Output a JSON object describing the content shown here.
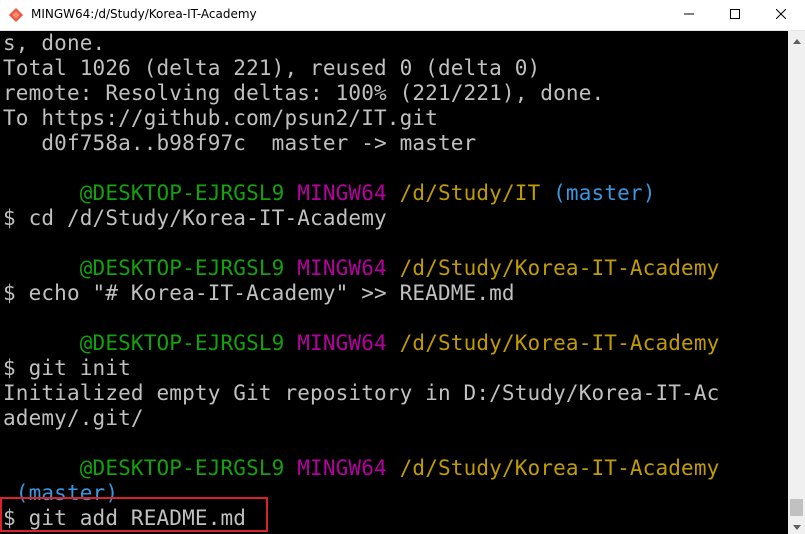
{
  "window": {
    "title": "MINGW64:/d/Study/Korea-IT-Academy",
    "app_icon": "mingw-diamond-icon",
    "controls": [
      "minimize-icon",
      "maximize-icon",
      "close-icon"
    ]
  },
  "terminal": {
    "lines": [
      {
        "segments": [
          {
            "text": "s, done.",
            "color": "white"
          }
        ]
      },
      {
        "segments": [
          {
            "text": "Total 1026 (delta 221), reused 0 (delta 0)",
            "color": "white"
          }
        ]
      },
      {
        "segments": [
          {
            "text": "remote: Resolving deltas: 100% (221/221), done.",
            "color": "white"
          }
        ]
      },
      {
        "segments": [
          {
            "text": "To https://github.com/psun2/IT.git",
            "color": "white"
          }
        ]
      },
      {
        "segments": [
          {
            "text": "   d0f758a..b98f97c  master -> master",
            "color": "white"
          }
        ]
      },
      {
        "segments": []
      },
      {
        "segments": [
          {
            "text": "      @DESKTOP-EJRGSL9 ",
            "color": "green"
          },
          {
            "text": "MINGW64 ",
            "color": "magenta"
          },
          {
            "text": "/d/Study/IT ",
            "color": "yellow"
          },
          {
            "text": "(master)",
            "color": "cyan"
          }
        ]
      },
      {
        "segments": [
          {
            "text": "$ cd /d/Study/Korea-IT-Academy",
            "color": "white"
          }
        ]
      },
      {
        "segments": []
      },
      {
        "segments": [
          {
            "text": "      @DESKTOP-EJRGSL9 ",
            "color": "green"
          },
          {
            "text": "MINGW64 ",
            "color": "magenta"
          },
          {
            "text": "/d/Study/Korea-IT-Academy",
            "color": "yellow"
          }
        ]
      },
      {
        "segments": [
          {
            "text": "$ echo \"# Korea-IT-Academy\" >> README.md",
            "color": "white"
          }
        ]
      },
      {
        "segments": []
      },
      {
        "segments": [
          {
            "text": "      @DESKTOP-EJRGSL9 ",
            "color": "green"
          },
          {
            "text": "MINGW64 ",
            "color": "magenta"
          },
          {
            "text": "/d/Study/Korea-IT-Academy",
            "color": "yellow"
          }
        ]
      },
      {
        "segments": [
          {
            "text": "$ git init",
            "color": "white"
          }
        ]
      },
      {
        "segments": [
          {
            "text": "Initialized empty Git repository in D:/Study/Korea-IT-Ac",
            "color": "white"
          }
        ]
      },
      {
        "segments": [
          {
            "text": "ademy/.git/",
            "color": "white"
          }
        ]
      },
      {
        "segments": []
      },
      {
        "segments": [
          {
            "text": "      @DESKTOP-EJRGSL9 ",
            "color": "green"
          },
          {
            "text": "MINGW64 ",
            "color": "magenta"
          },
          {
            "text": "/d/Study/Korea-IT-Academy",
            "color": "yellow"
          }
        ]
      },
      {
        "segments": [
          {
            "text": " (master)",
            "color": "cyan"
          }
        ]
      },
      {
        "segments": [
          {
            "text": "$ git add README.md",
            "color": "white"
          }
        ]
      }
    ]
  },
  "colors": {
    "white": "#c0c0c0",
    "green": "#13a10e",
    "magenta": "#b4009e",
    "yellow": "#c19c00",
    "cyan": "#3a96dd",
    "highlight_border": "#d8232a",
    "background": "#000000"
  }
}
